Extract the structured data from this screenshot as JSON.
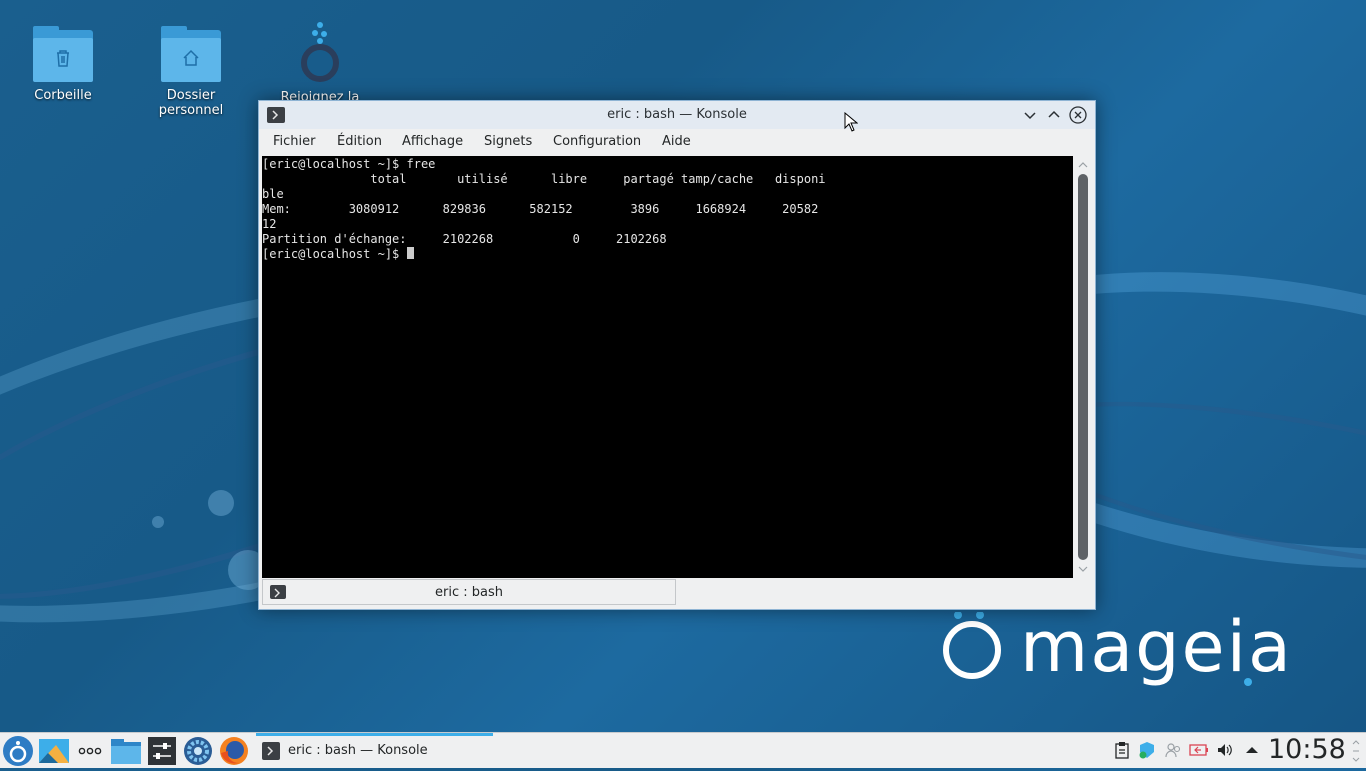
{
  "desktop": {
    "icons": [
      {
        "label": "Corbeille"
      },
      {
        "label": "Dossier personnel"
      },
      {
        "label": "Rejoignez la"
      }
    ],
    "brand": "mageia"
  },
  "window": {
    "title": "eric : bash — Konsole",
    "menu": [
      "Fichier",
      "Édition",
      "Affichage",
      "Signets",
      "Configuration",
      "Aide"
    ],
    "terminal_lines": [
      "[eric@localhost ~]$ free",
      "               total       utilisé      libre     partagé tamp/cache   disponi",
      "ble",
      "Mem:        3080912      829836      582152        3896     1668924     20582",
      "12",
      "Partition d'échange:     2102268           0     2102268",
      "[eric@localhost ~]$ "
    ],
    "tab_label": "eric : bash"
  },
  "taskbar": {
    "task_label": "eric : bash — Konsole",
    "clock": "10:58"
  },
  "colors": {
    "accent": "#3daee9",
    "desktop": "#1a5f8e",
    "terminal_bg": "#000000"
  }
}
